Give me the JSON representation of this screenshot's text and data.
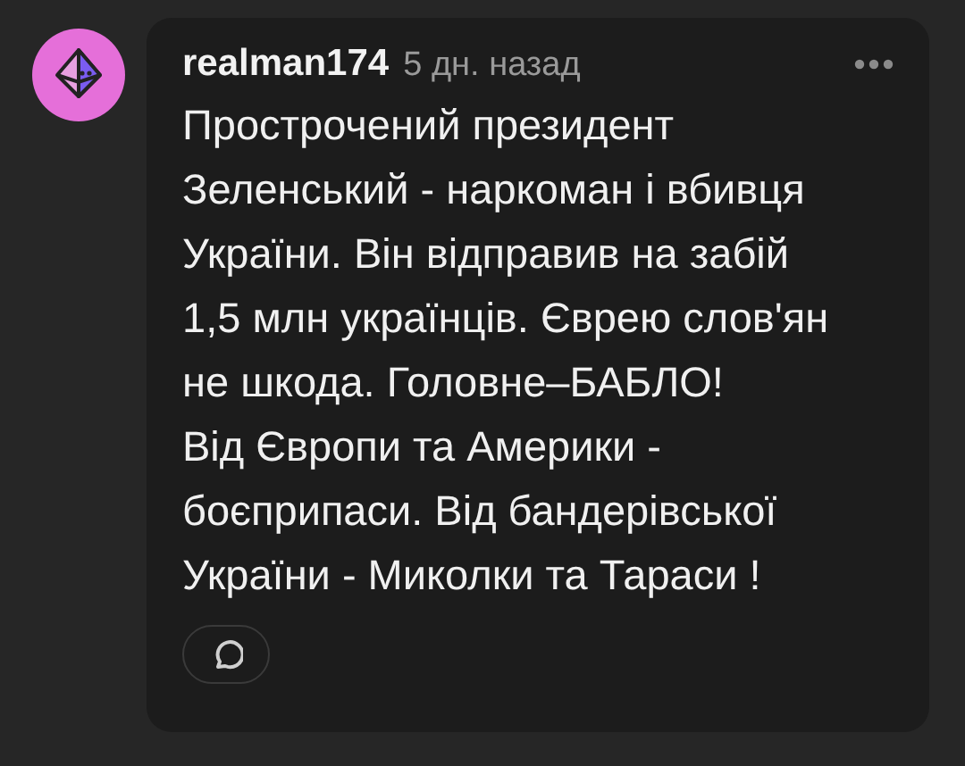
{
  "comment": {
    "author": "realman174",
    "time": "5 дн. назад",
    "lines": [
      "Прострочений президент",
      "Зеленський - наркоман і вбивця",
      "України. Він відправив на забій",
      "1,5 млн українців. Єврею слов'ян",
      "не шкода. Головне–БАБЛО!",
      "Від Європи та Америки -",
      "боєприпаси. Від бандерівської",
      "України - Миколки та Тараси !"
    ]
  }
}
